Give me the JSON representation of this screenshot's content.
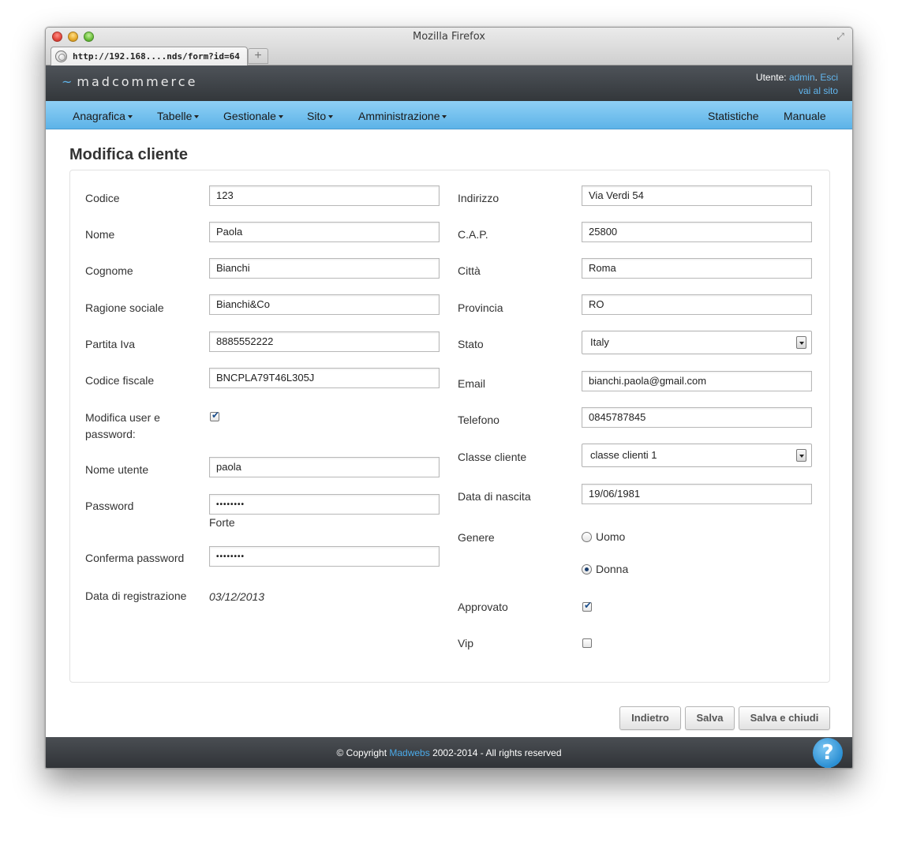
{
  "window": {
    "title": "Mozilla Firefox"
  },
  "tab": {
    "url": "http://192.168....nds/form?id=64",
    "new_tab": "+"
  },
  "app": {
    "logo_tilde": "~",
    "logo": "madcommerce"
  },
  "user": {
    "label": "Utente:",
    "name": "admin",
    "sep": ".",
    "logout": "Esci",
    "site_link": "vai al sito"
  },
  "nav": {
    "left": [
      "Anagrafica",
      "Tabelle",
      "Gestionale",
      "Sito",
      "Amministrazione"
    ],
    "right": [
      "Statistiche",
      "Manuale"
    ]
  },
  "page": {
    "title": "Modifica cliente"
  },
  "form": {
    "codice": {
      "label": "Codice",
      "value": "123"
    },
    "nome": {
      "label": "Nome",
      "value": "Paola"
    },
    "cognome": {
      "label": "Cognome",
      "value": "Bianchi"
    },
    "ragione_sociale": {
      "label": "Ragione sociale",
      "value": "Bianchi&Co"
    },
    "partita_iva": {
      "label": "Partita Iva",
      "value": "8885552222"
    },
    "codice_fiscale": {
      "label": "Codice fiscale",
      "value": "BNCPLA79T46L305J"
    },
    "modifica_user": {
      "label_line1": "Modifica user e",
      "label_line2": "password:",
      "checked": true
    },
    "nome_utente": {
      "label": "Nome utente",
      "value": "paola"
    },
    "password": {
      "label": "Password",
      "value": "••••••••",
      "strength": "Forte"
    },
    "conferma_password": {
      "label": "Conferma password",
      "value": "••••••••"
    },
    "data_registrazione": {
      "label": "Data di registrazione",
      "value": "03/12/2013"
    },
    "indirizzo": {
      "label": "Indirizzo",
      "value": "Via Verdi 54"
    },
    "cap": {
      "label": "C.A.P.",
      "value": "25800"
    },
    "citta": {
      "label": "Città",
      "value": "Roma"
    },
    "provincia": {
      "label": "Provincia",
      "value": "RO"
    },
    "stato": {
      "label": "Stato",
      "value": "Italy"
    },
    "email": {
      "label": "Email",
      "value": "bianchi.paola@gmail.com"
    },
    "telefono": {
      "label": "Telefono",
      "value": "0845787845"
    },
    "classe_cliente": {
      "label": "Classe cliente",
      "value": "classe clienti 1"
    },
    "data_nascita": {
      "label": "Data di nascita",
      "value": "19/06/1981"
    },
    "genere": {
      "label": "Genere",
      "options": [
        "Uomo",
        "Donna"
      ],
      "selected": "Donna"
    },
    "approvato": {
      "label": "Approvato",
      "checked": true
    },
    "vip": {
      "label": "Vip",
      "checked": false
    }
  },
  "buttons": {
    "back": "Indietro",
    "save": "Salva",
    "save_close": "Salva e chiudi"
  },
  "footer": {
    "prefix": "© Copyright ",
    "company": "Madwebs",
    "suffix": " 2002-2014 - All rights reserved",
    "help": "?"
  },
  "colors": {
    "nav_bg": "#6fbfee",
    "header_bg": "#3d4146",
    "link": "#62b6ee"
  }
}
